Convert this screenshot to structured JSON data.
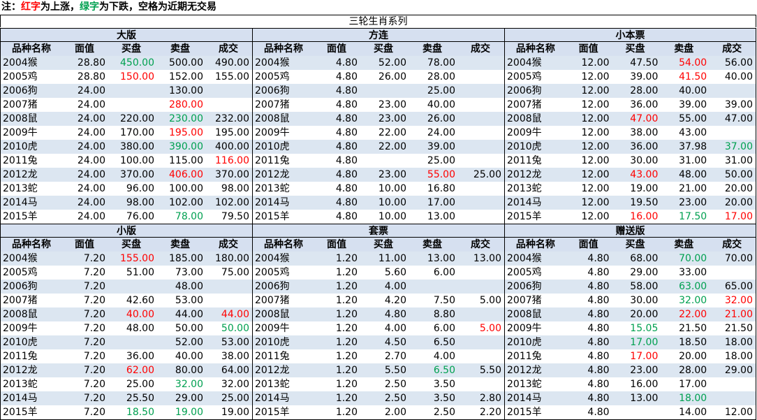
{
  "note": {
    "prefix": "注：",
    "red": "红字",
    "mid1": "为上涨，",
    "green": "绿字",
    "mid2": "为下跌，空格为近期无交易"
  },
  "title": "三轮生肖系列",
  "columns": [
    "品种名称",
    "面值",
    "买盘",
    "卖盘",
    "成交"
  ],
  "panels": [
    {
      "name": "大版",
      "rows": [
        [
          "2004猴",
          "28.80",
          {
            "v": "450.00",
            "c": "down"
          },
          "500.00",
          "490.00"
        ],
        [
          "2005鸡",
          "28.80",
          {
            "v": "150.00",
            "c": "up"
          },
          "152.00",
          "155.00"
        ],
        [
          "2006狗",
          "24.00",
          "",
          "130.00",
          ""
        ],
        [
          "2007猪",
          "24.00",
          "",
          {
            "v": "280.00",
            "c": "up"
          },
          ""
        ],
        [
          "2008鼠",
          "24.00",
          "220.00",
          {
            "v": "230.00",
            "c": "down"
          },
          "232.00"
        ],
        [
          "2009牛",
          "24.00",
          "170.00",
          {
            "v": "195.00",
            "c": "up"
          },
          "195.00"
        ],
        [
          "2010虎",
          "24.00",
          "380.00",
          {
            "v": "390.00",
            "c": "down"
          },
          "400.00"
        ],
        [
          "2011兔",
          "24.00",
          "100.00",
          "115.00",
          {
            "v": "116.00",
            "c": "up"
          }
        ],
        [
          "2012龙",
          "24.00",
          "370.00",
          {
            "v": "406.00",
            "c": "up"
          },
          "370.00"
        ],
        [
          "2013蛇",
          "24.00",
          "96.00",
          "100.00",
          "98.00"
        ],
        [
          "2014马",
          "24.00",
          "98.00",
          "102.00",
          "102.00"
        ],
        [
          "2015羊",
          "24.00",
          "76.00",
          {
            "v": "78.00",
            "c": "down"
          },
          "79.50"
        ]
      ]
    },
    {
      "name": "方连",
      "rows": [
        [
          "2004猴",
          "4.80",
          "52.00",
          "78.00",
          ""
        ],
        [
          "2005鸡",
          "4.80",
          "26.00",
          "28.00",
          ""
        ],
        [
          "2006狗",
          "4.80",
          "",
          "25.00",
          ""
        ],
        [
          "2007猪",
          "4.80",
          "23.00",
          "40.00",
          ""
        ],
        [
          "2008鼠",
          "4.80",
          "23.00",
          "26.00",
          ""
        ],
        [
          "2009牛",
          "4.80",
          "22.00",
          "24.00",
          ""
        ],
        [
          "2010虎",
          "4.80",
          "22.00",
          "39.00",
          ""
        ],
        [
          "2011兔",
          "4.80",
          "",
          "25.00",
          ""
        ],
        [
          "2012龙",
          "4.80",
          "23.00",
          {
            "v": "55.00",
            "c": "up"
          },
          "25.00"
        ],
        [
          "2013蛇",
          "4.80",
          "10.00",
          "16.80",
          ""
        ],
        [
          "2014马",
          "4.80",
          "10.00",
          "17.00",
          ""
        ],
        [
          "2015羊",
          "4.80",
          "10.00",
          "13.00",
          ""
        ]
      ]
    },
    {
      "name": "小本票",
      "rows": [
        [
          "2004猴",
          "12.00",
          "47.50",
          {
            "v": "54.00",
            "c": "up"
          },
          "56.00"
        ],
        [
          "2005鸡",
          "12.00",
          "39.00",
          {
            "v": "41.50",
            "c": "up"
          },
          "40.00"
        ],
        [
          "2006狗",
          "12.00",
          "28.00",
          "40.00",
          ""
        ],
        [
          "2007猪",
          "12.00",
          "36.00",
          "39.00",
          "39.00"
        ],
        [
          "2008鼠",
          "12.00",
          {
            "v": "47.00",
            "c": "up"
          },
          "55.00",
          "47.00"
        ],
        [
          "2009牛",
          "12.00",
          "38.00",
          "43.00",
          ""
        ],
        [
          "2010虎",
          "12.00",
          "36.00",
          "37.98",
          {
            "v": "37.00",
            "c": "down"
          }
        ],
        [
          "2011兔",
          "12.00",
          "30.00",
          "31.00",
          "31.00"
        ],
        [
          "2012龙",
          "12.00",
          {
            "v": "43.00",
            "c": "up"
          },
          "48.00",
          "50.00"
        ],
        [
          "2013蛇",
          "12.00",
          "19.00",
          "21.00",
          "20.00"
        ],
        [
          "2014马",
          "12.00",
          "19.50",
          "23.00",
          "20.00"
        ],
        [
          "2015羊",
          "12.00",
          {
            "v": "16.00",
            "c": "up"
          },
          {
            "v": "17.50",
            "c": "down"
          },
          {
            "v": "17.00",
            "c": "up"
          }
        ]
      ]
    },
    {
      "name": "小版",
      "rows": [
        [
          "2004猴",
          "7.20",
          {
            "v": "155.00",
            "c": "up"
          },
          "185.00",
          "180.00"
        ],
        [
          "2005鸡",
          "7.20",
          "51.00",
          "73.00",
          "75.00"
        ],
        [
          "2006狗",
          "7.20",
          "",
          "48.00",
          ""
        ],
        [
          "2007猪",
          "7.20",
          "42.60",
          "53.00",
          ""
        ],
        [
          "2008鼠",
          "7.20",
          {
            "v": "40.00",
            "c": "up"
          },
          "44.00",
          {
            "v": "44.00",
            "c": "up"
          }
        ],
        [
          "2009牛",
          "7.20",
          "48.00",
          "50.00",
          {
            "v": "50.00",
            "c": "down"
          }
        ],
        [
          "2010虎",
          "7.20",
          "",
          "52.00",
          "53.00"
        ],
        [
          "2011兔",
          "7.20",
          "36.00",
          "40.00",
          "38.00"
        ],
        [
          "2012龙",
          "7.20",
          {
            "v": "62.00",
            "c": "up"
          },
          "80.00",
          "64.00"
        ],
        [
          "2013蛇",
          "7.20",
          "25.00",
          {
            "v": "32.00",
            "c": "down"
          },
          "32.00"
        ],
        [
          "2014马",
          "7.20",
          "25.50",
          "29.00",
          "25.00"
        ],
        [
          "2015羊",
          "7.20",
          {
            "v": "18.50",
            "c": "down"
          },
          {
            "v": "19.00",
            "c": "down"
          },
          "19.00"
        ]
      ]
    },
    {
      "name": "套票",
      "rows": [
        [
          "2004猴",
          "1.20",
          "11.00",
          "13.00",
          "13.00"
        ],
        [
          "2005鸡",
          "1.20",
          "5.60",
          "6.00",
          ""
        ],
        [
          "2006狗",
          "1.20",
          "4.00",
          "",
          ""
        ],
        [
          "2007猪",
          "1.20",
          "4.20",
          "7.50",
          "5.00"
        ],
        [
          "2008鼠",
          "1.20",
          "4.80",
          "8.80",
          ""
        ],
        [
          "2009牛",
          "1.20",
          "4.00",
          "6.00",
          {
            "v": "5.00",
            "c": "up"
          }
        ],
        [
          "2010虎",
          "1.20",
          "4.50",
          "6.50",
          ""
        ],
        [
          "2011兔",
          "1.20",
          "2.70",
          "4.00",
          ""
        ],
        [
          "2012龙",
          "1.20",
          "5.50",
          {
            "v": "6.50",
            "c": "down"
          },
          "5.50"
        ],
        [
          "2013蛇",
          "1.20",
          "2.50",
          "3.50",
          ""
        ],
        [
          "2014马",
          "1.20",
          "2.50",
          "3.50",
          "2.80"
        ],
        [
          "2015羊",
          "1.20",
          "2.00",
          "2.50",
          "2.20"
        ]
      ]
    },
    {
      "name": "赠送版",
      "rows": [
        [
          "2004猴",
          "4.80",
          "68.00",
          {
            "v": "70.00",
            "c": "down"
          },
          "70.00"
        ],
        [
          "2005鸡",
          "4.80",
          "29.00",
          "33.00",
          ""
        ],
        [
          "2006狗",
          "4.80",
          "58.00",
          {
            "v": "63.00",
            "c": "down"
          },
          "65.00"
        ],
        [
          "2007猪",
          "4.80",
          "30.00",
          {
            "v": "32.00",
            "c": "down"
          },
          {
            "v": "32.00",
            "c": "up"
          }
        ],
        [
          "2008鼠",
          "4.80",
          "20.00",
          {
            "v": "22.00",
            "c": "up"
          },
          {
            "v": "21.00",
            "c": "up"
          }
        ],
        [
          "2009牛",
          "4.80",
          {
            "v": "15.05",
            "c": "down"
          },
          "21.50",
          "21.50"
        ],
        [
          "2010虎",
          "4.80",
          {
            "v": "17.00",
            "c": "down"
          },
          "18.50",
          "18.00"
        ],
        [
          "2011兔",
          "4.80",
          {
            "v": "17.00",
            "c": "up"
          },
          "20.00",
          "18.00"
        ],
        [
          "2012龙",
          "4.80",
          "23.00",
          "28.00",
          "29.00"
        ],
        [
          "2013蛇",
          "4.80",
          "16.00",
          "17.00",
          ""
        ],
        [
          "2014马",
          "4.80",
          "13.00",
          {
            "v": "18.00",
            "c": "down"
          },
          ""
        ],
        [
          "2015羊",
          "4.80",
          "",
          "14.00",
          "12.00"
        ]
      ]
    }
  ]
}
